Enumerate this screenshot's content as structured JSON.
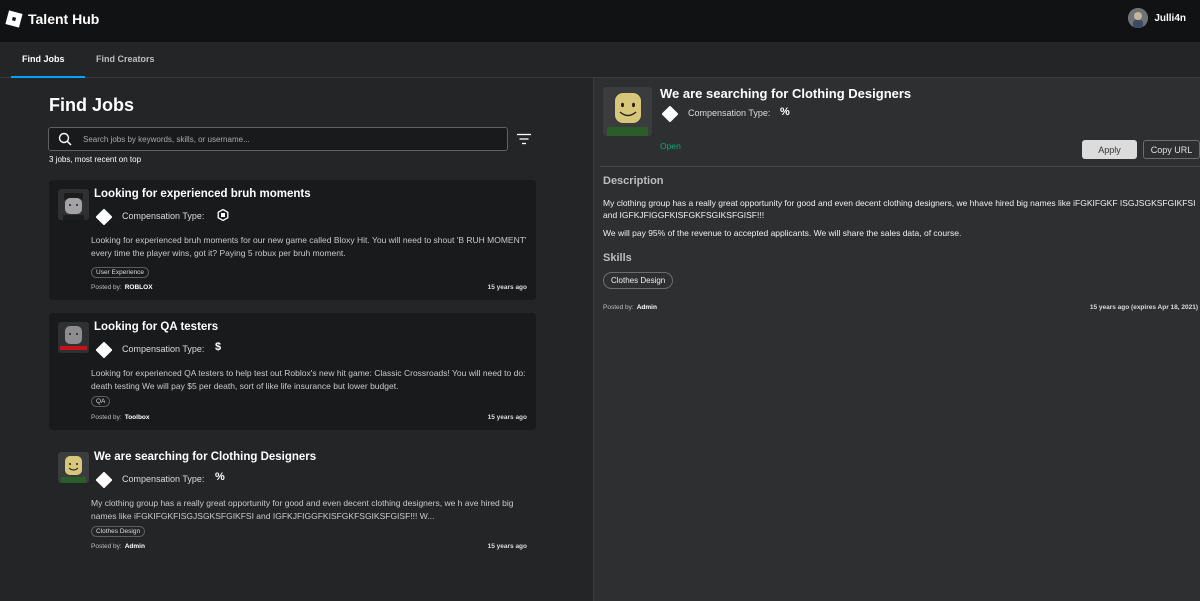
{
  "app": {
    "title": "Talent Hub"
  },
  "user": {
    "name": "Julli4n"
  },
  "tabs": [
    {
      "label": "Find Jobs"
    },
    {
      "label": "Find Creators"
    }
  ],
  "main": {
    "title": "Find Jobs",
    "search_placeholder": "Search jobs by keywords, skills, or username...",
    "count_text": "3 jobs, most recent on top"
  },
  "jobs": [
    {
      "title": "Looking for experienced bruh moments",
      "comp_label": "Compensation Type:",
      "comp_value": "robux-icon",
      "description": "Looking for experienced bruh moments for our new game called Bloxy Hit. You will need to shout 'B RUH MOMENT' every time the player wins, got it? Paying 5 robux per bruh moment.",
      "tag": "User Experience",
      "posted_label": "Posted by:",
      "posted_by": "ROBLOX",
      "age": "15 years ago"
    },
    {
      "title": "Looking for QA testers",
      "comp_label": "Compensation Type:",
      "comp_value": "$",
      "description": "Looking for experienced QA testers to help test out Roblox's new hit game: Classic Crossroads! You will need to do: death testing We will pay $5 per death, sort of like life insurance but lower budget.",
      "tag": "QA",
      "posted_label": "Posted by:",
      "posted_by": "Toolbox",
      "age": "15 years ago"
    },
    {
      "title": "We are searching for Clothing Designers",
      "comp_label": "Compensation Type:",
      "comp_value": "%",
      "description": "My clothing group has a really great opportunity for good and even decent clothing designers, we h ave hired big names like iFGKIFGKFISGJSGKSFGIKFSI and IGFKJFIGGFKISFGKFSGIKSFGISF!!! W...",
      "tag": "Clothes Design",
      "posted_label": "Posted by:",
      "posted_by": "Admin",
      "age": "15 years ago"
    }
  ],
  "detail": {
    "title": "We are searching for Clothing Designers",
    "comp_label": "Compensation Type:",
    "comp_value": "%",
    "status": "Open",
    "apply_label": "Apply",
    "copy_label": "Copy URL",
    "description_heading": "Description",
    "description_p1": "My clothing group has a really great opportunity for good and even decent clothing designers, we hhave hired big names like iFGKIFGKF ISGJSGKSFGIKFSI and IGFKJFIGGFKISFGKFSGIKSFGISF!!!",
    "description_p2": "We will pay 95% of the revenue to accepted applicants. We will share the sales data, of course.",
    "skills_heading": "Skills",
    "skill": "Clothes Design",
    "posted_label": "Posted by:",
    "posted_by": "Admin",
    "age": "15 years ago (expires Apr 18, 2021)"
  },
  "colors": {
    "accent": "#00a2ff",
    "open": "#00b06f",
    "background": "#232527",
    "panel": "#2d2f31",
    "card": "#191a1b"
  }
}
